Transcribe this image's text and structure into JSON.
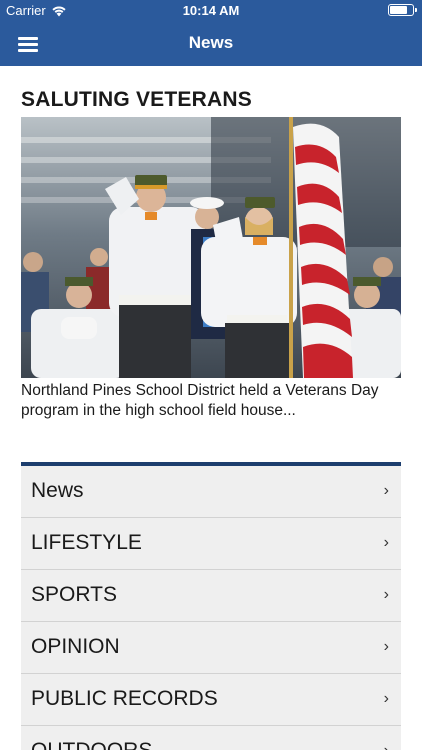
{
  "status": {
    "carrier": "Carrier",
    "time": "10:14 AM",
    "battery_level": 0.8
  },
  "nav": {
    "title": "News",
    "menu_icon": "hamburger-menu-icon"
  },
  "article": {
    "headline": "SALUTING VETERANS",
    "caption": "Northland Pines School District held a Veterans Day program in the high school field house..."
  },
  "sections": [
    {
      "label": "News"
    },
    {
      "label": "LIFESTYLE"
    },
    {
      "label": "SPORTS"
    },
    {
      "label": "OPINION"
    },
    {
      "label": "PUBLIC RECORDS"
    },
    {
      "label": "OUTDOORS"
    }
  ],
  "colors": {
    "nav_bar": "#2b5a9c",
    "divider": "#1d3e6e",
    "row_bg": "#efefef"
  }
}
